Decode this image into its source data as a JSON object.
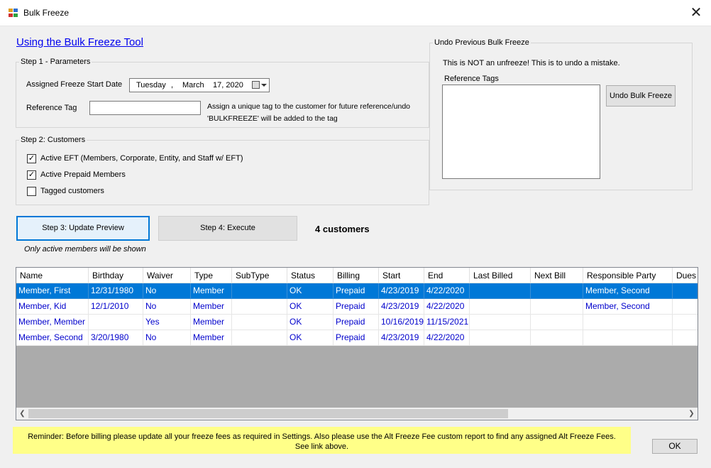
{
  "window": {
    "title": "Bulk Freeze",
    "close_glyph": "✕"
  },
  "link": "Using the Bulk Freeze Tool",
  "step1": {
    "legend": "Step 1 - Parameters",
    "date_label": "Assigned Freeze Start Date",
    "date_day": "Tuesday",
    "date_sep": ",",
    "date_month": "March",
    "date_daynum": "17, 2020",
    "ref_label": "Reference Tag",
    "ref_value": "",
    "hint_line1": "Assign a unique tag to the customer for future reference/undo",
    "hint_line2": "'BULKFREEZE' will be added to the tag"
  },
  "step2": {
    "legend": "Step 2: Customers",
    "checkboxes": [
      {
        "label": "Active EFT (Members, Corporate, Entity, and Staff w/ EFT)",
        "checked": true
      },
      {
        "label": "Active Prepaid Members",
        "checked": true
      },
      {
        "label": "Tagged customers",
        "checked": false
      }
    ]
  },
  "undo": {
    "legend": "Undo Previous Bulk Freeze",
    "note": "This is NOT an unfreeze!  This is to undo a mistake.",
    "tags_label": "Reference Tags",
    "button": "Undo Bulk Freeze"
  },
  "actions": {
    "preview_button": "Step 3: Update Preview",
    "execute_button": "Step 4: Execute",
    "count": "4 customers",
    "note": "Only active members will be shown"
  },
  "table": {
    "columns": [
      "Name",
      "Birthday",
      "Waiver",
      "Type",
      "SubType",
      "Status",
      "Billing",
      "Start",
      "End",
      "Last Billed",
      "Next Bill",
      "Responsible Party",
      "Dues"
    ],
    "rows": [
      [
        "Member, First",
        "12/31/1980",
        "No",
        "Member",
        "",
        "OK",
        "Prepaid",
        "4/23/2019",
        "4/22/2020",
        "",
        "",
        "Member, Second",
        ""
      ],
      [
        "Member, Kid",
        "12/1/2010",
        "No",
        "Member",
        "",
        "OK",
        "Prepaid",
        "4/23/2019",
        "4/22/2020",
        "",
        "",
        "Member, Second",
        ""
      ],
      [
        "Member, Member",
        "",
        "Yes",
        "Member",
        "",
        "OK",
        "Prepaid",
        "10/16/2019",
        "11/15/2021",
        "",
        "",
        "",
        ""
      ],
      [
        "Member, Second",
        "3/20/1980",
        "No",
        "Member",
        "",
        "OK",
        "Prepaid",
        "4/23/2019",
        "4/22/2020",
        "",
        "",
        "",
        ""
      ]
    ],
    "selected_row": 0
  },
  "reminder": "Reminder:  Before billing please update all your freeze fees as required in Settings.  Also please use the Alt Freeze Fee custom report to find any assigned Alt Freeze Fees. See link above.",
  "ok_button": "OK",
  "colors": {
    "selection": "#0078d7",
    "row_text": "#0000cc",
    "reminder_bg": "#ffff88",
    "link": "#0000ee"
  }
}
